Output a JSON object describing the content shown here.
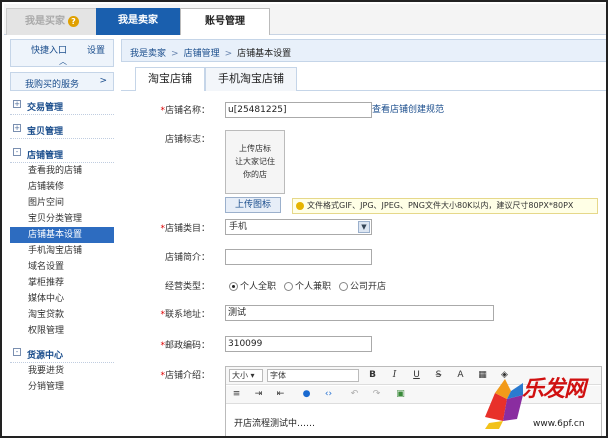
{
  "top_tabs": {
    "buyer": "我是买家",
    "seller": "我是卖家",
    "account": "账号管理"
  },
  "sidebar": {
    "quick_title": "快捷入口",
    "quick_settings": "设置",
    "services_label": "我购买的服务",
    "services_arrow": ">",
    "sections": [
      {
        "title": "交易管理",
        "toggle": "+"
      },
      {
        "title": "宝贝管理",
        "toggle": "+"
      },
      {
        "title": "店铺管理",
        "toggle": "-"
      },
      {
        "title": "货源中心",
        "toggle": "-"
      }
    ],
    "shop_items": [
      "查看我的店铺",
      "店铺装修",
      "图片空间",
      "宝贝分类管理",
      "店铺基本设置",
      "手机淘宝店铺",
      "域名设置",
      "掌柜推荐",
      "媒体中心",
      "淘宝贷款",
      "权限管理"
    ],
    "supply_items": [
      "我要进货",
      "分销管理"
    ]
  },
  "breadcrumb": {
    "root": "我是卖家",
    "parent": "店铺管理",
    "current": "店铺基本设置",
    "sep": ">"
  },
  "page_tabs": {
    "taobao": "淘宝店铺",
    "mobile": "手机淘宝店铺"
  },
  "form": {
    "required_mark": "*",
    "name_label": "店铺名称：",
    "name_value": "u[25481225]",
    "name_rule_link": "查看店铺创建规范",
    "logo_label": "店铺标志：",
    "logo_line1": "上传店标",
    "logo_line2": "让大家记住",
    "logo_line3": "你的店",
    "upload_button": "上传图标",
    "upload_tip": "文件格式GIF、JPG、JPEG、PNG文件大小80K以内，建议尺寸80PX*80PX",
    "category_label": "店铺类目：",
    "category_value": "手机",
    "intro_label": "店铺简介：",
    "intro_value": "",
    "biz_type_label": "经营类型：",
    "biz_options": [
      "个人全职",
      "个人兼职",
      "公司开店"
    ],
    "biz_selected": "个人全职",
    "address_label": "联系地址：",
    "address_value": "测试",
    "zip_label": "邮政编码：",
    "zip_value": "310099",
    "desc_label": "店铺介绍："
  },
  "editor": {
    "size_select": "大小",
    "font_select": "字体",
    "content": "开店流程测试中……"
  },
  "watermark": {
    "text": "乐发网",
    "url": "www.6pf.cn"
  }
}
